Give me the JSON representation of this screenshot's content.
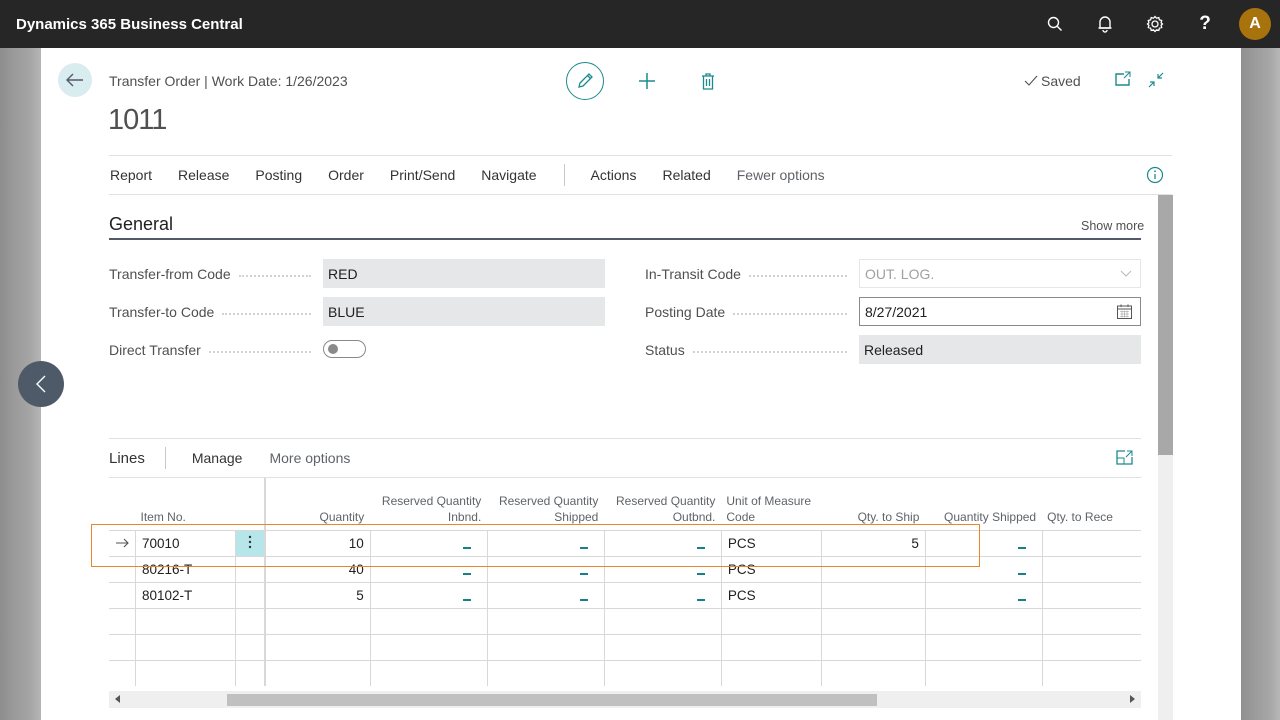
{
  "app": {
    "title": "Dynamics 365 Business Central",
    "avatar_initial": "A",
    "topbar_icons": [
      "search-icon",
      "bell-icon",
      "gear-icon",
      "help-icon"
    ]
  },
  "header": {
    "caption": "Transfer Order | Work Date: 1/26/2023",
    "document_no": "1011",
    "saved_label": "Saved"
  },
  "actions": {
    "items": [
      "Report",
      "Release",
      "Posting",
      "Order",
      "Print/Send",
      "Navigate"
    ],
    "secondary": [
      "Actions",
      "Related"
    ],
    "fewer_options": "Fewer options"
  },
  "general": {
    "title": "General",
    "show_more": "Show more",
    "fields": {
      "transfer_from_code": {
        "label": "Transfer-from Code",
        "value": "RED"
      },
      "transfer_to_code": {
        "label": "Transfer-to Code",
        "value": "BLUE"
      },
      "direct_transfer": {
        "label": "Direct Transfer",
        "value": false
      },
      "in_transit_code": {
        "label": "In-Transit Code",
        "value": "OUT. LOG."
      },
      "posting_date": {
        "label": "Posting Date",
        "value": "8/27/2021"
      },
      "status": {
        "label": "Status",
        "value": "Released"
      }
    }
  },
  "lines": {
    "title": "Lines",
    "manage": "Manage",
    "more_options": "More options",
    "columns": [
      "Item No.",
      "Quantity",
      "Reserved Quantity Inbnd.",
      "Reserved Quantity Shipped",
      "Reserved Quantity Outbnd.",
      "Unit of Measure Code",
      "Qty. to Ship",
      "Quantity Shipped",
      "Qty. to Rece"
    ],
    "rows": [
      {
        "item_no": "70010",
        "quantity": "10",
        "res_inbnd": "_",
        "res_shipped": "_",
        "res_outbnd": "_",
        "uom": "PCS",
        "qty_to_ship": "5",
        "qty_shipped": "_",
        "qty_to_receive": ""
      },
      {
        "item_no": "80216-T",
        "quantity": "40",
        "res_inbnd": "_",
        "res_shipped": "_",
        "res_outbnd": "_",
        "uom": "PCS",
        "qty_to_ship": "",
        "qty_shipped": "_",
        "qty_to_receive": ""
      },
      {
        "item_no": "80102-T",
        "quantity": "5",
        "res_inbnd": "_",
        "res_shipped": "_",
        "res_outbnd": "_",
        "uom": "PCS",
        "qty_to_ship": "",
        "qty_shipped": "_",
        "qty_to_receive": ""
      }
    ],
    "selected_row_index": 0
  },
  "colors": {
    "accent": "#1b8a8f",
    "topbar": "#262626",
    "avatar": "#a8730c",
    "focus_outline": "#e8862a",
    "selected_cell": "#b6e5ea"
  }
}
